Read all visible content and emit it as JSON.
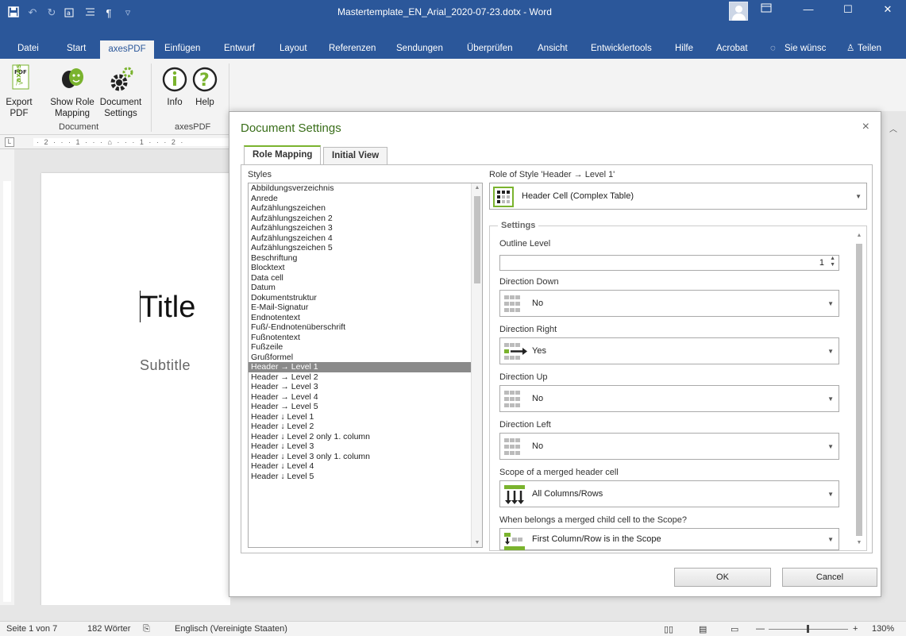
{
  "window": {
    "title": "Mastertemplate_EN_Arial_2020-07-23.dotx  -  Word"
  },
  "qat": {
    "save": "save-icon",
    "undo": "undo-icon",
    "redo": "redo-icon",
    "pilcrow": "¶"
  },
  "tabs": [
    "Datei",
    "Start",
    "axesPDF",
    "Einfügen",
    "Entwurf",
    "Layout",
    "Referenzen",
    "Sendungen",
    "Überprüfen",
    "Ansicht",
    "Entwicklertools",
    "Hilfe",
    "Acrobat",
    "Sie wünsc",
    "Teilen"
  ],
  "ribbon": {
    "export_pdf": "Export\nPDF",
    "show_role_mapping": "Show Role\nMapping",
    "document_settings": "Document\nSettings",
    "info": "Info",
    "help": "Help",
    "group_document": "Document",
    "group_axespdf": "axesPDF"
  },
  "ruler": {
    "marks": "· 2 · · · 1 · · · ⌂ · · · 1 · · · 2 ·",
    "corner": "L"
  },
  "document": {
    "title": "Title",
    "subtitle": "Subtitle"
  },
  "statusbar": {
    "page": "Seite 1 von 7",
    "words": "182 Wörter",
    "language": "Englisch (Vereinigte Staaten)",
    "zoom": "130%",
    "zoom_minus": "—",
    "zoom_plus": "+"
  },
  "dialog": {
    "title": "Document Settings",
    "close": "×",
    "tabs": [
      "Role Mapping",
      "Initial View"
    ],
    "styles_label": "Styles",
    "styles": [
      "Abbildungsverzeichnis",
      "Anrede",
      "Aufzählungszeichen",
      "Aufzählungszeichen 2",
      "Aufzählungszeichen 3",
      "Aufzählungszeichen 4",
      "Aufzählungszeichen 5",
      "Beschriftung",
      "Blocktext",
      "Data cell",
      "Datum",
      "Dokumentstruktur",
      "E-Mail-Signatur",
      "Endnotentext",
      "Fuß/-Endnotenüberschrift",
      "Fußnotentext",
      "Fußzeile",
      "Grußformel",
      "Header → Level 1",
      "Header → Level 2",
      "Header → Level 3",
      "Header → Level 4",
      "Header → Level 5",
      "Header ↓ Level 1",
      "Header ↓ Level 2",
      "Header ↓ Level 2 only 1. column",
      "Header ↓ Level 3",
      "Header ↓ Level 3 only 1. column",
      "Header ↓ Level 4",
      "Header ↓ Level 5"
    ],
    "selected_style_index": 18,
    "role_label": "Role of Style 'Header → Level 1'",
    "role_value": "Header Cell (Complex Table)",
    "settings_legend": "Settings",
    "outline_label": "Outline Level",
    "outline_value": "1",
    "direction_down_label": "Direction Down",
    "direction_down_value": "No",
    "direction_right_label": "Direction Right",
    "direction_right_value": "Yes",
    "direction_up_label": "Direction Up",
    "direction_up_value": "No",
    "direction_left_label": "Direction Left",
    "direction_left_value": "No",
    "scope_label": "Scope of a merged header cell",
    "scope_value": "All Columns/Rows",
    "child_label": "When belongs a merged child cell to the Scope?",
    "child_value": "First Column/Row is in the Scope",
    "ok": "OK",
    "cancel": "Cancel"
  },
  "colors": {
    "word_blue": "#2b579a",
    "accent_green": "#7ab32e",
    "title_green": "#3a6e1a"
  }
}
